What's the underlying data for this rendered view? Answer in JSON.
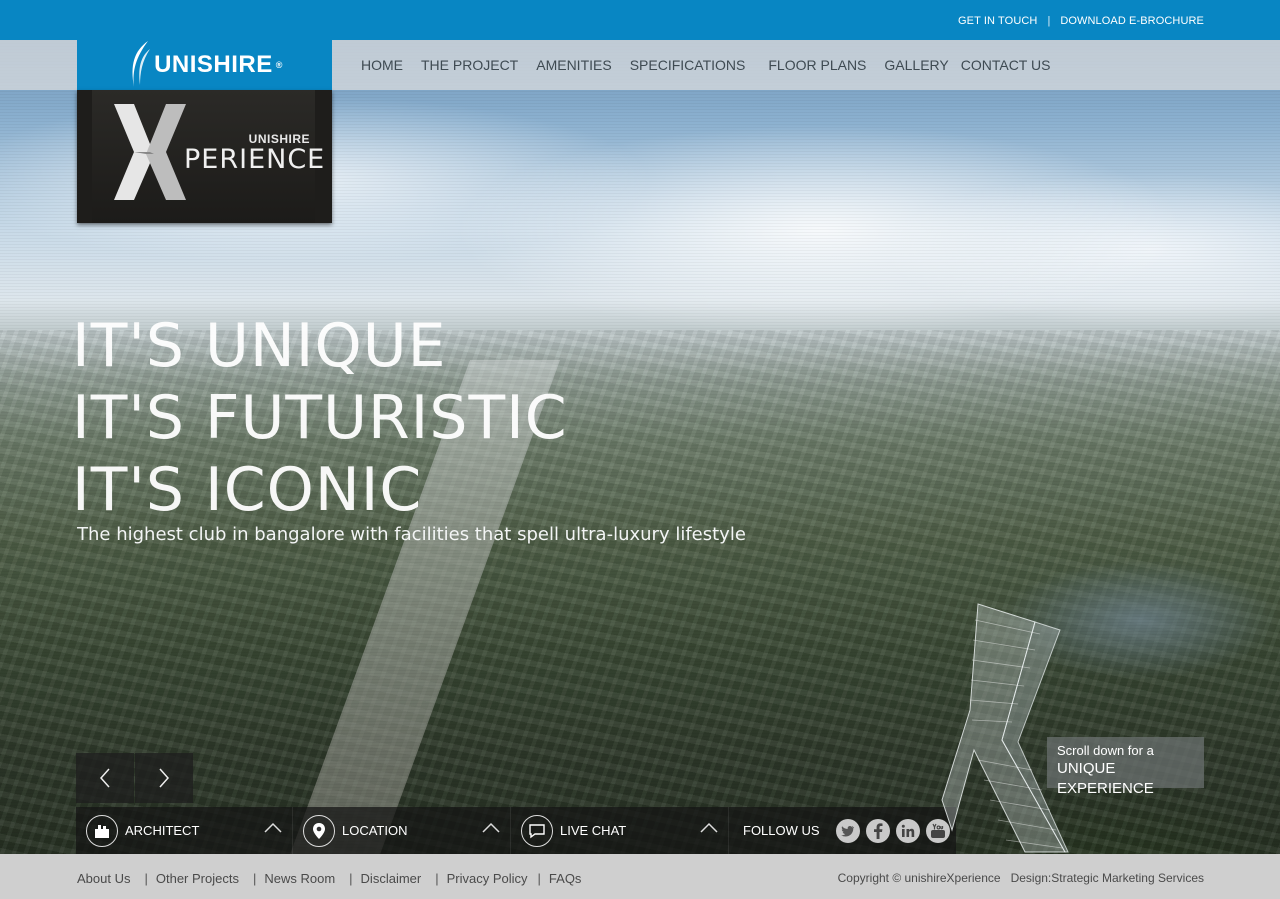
{
  "top_links": {
    "get_in_touch": "GET IN TOUCH",
    "separator": "|",
    "download": "DOWNLOAD E-BROCHURE"
  },
  "logo": {
    "brand": "UNISHIRE",
    "registered": "®"
  },
  "xperience_logo": {
    "small": "UNISHIRE",
    "word": "PERIENCE"
  },
  "nav": {
    "items": [
      "HOME",
      "THE PROJECT",
      "AMENITIES",
      "SPECIFICATIONS",
      "FLOOR PLANS",
      "GALLERY",
      "CONTACT US"
    ]
  },
  "hero": {
    "lines": [
      "IT'S  UNIQUE",
      "IT'S  FUTURISTIC",
      "IT'S  ICONIC"
    ],
    "tagline": "The highest club in bangalore with facilities that spell ultra-luxury lifestyle"
  },
  "bottom_bar": {
    "architect": "ARCHITECT",
    "location": "LOCATION",
    "live_chat": "LIVE CHAT",
    "follow_us": "FOLLOW US"
  },
  "scroll_hint": {
    "line1": "Scroll down for a",
    "line2": "UNIQUE EXPERIENCE"
  },
  "footer": {
    "links": [
      "About Us",
      "Other Projects",
      "News Room",
      "Disclaimer",
      "Privacy Policy",
      "FAQs"
    ],
    "separator": "|",
    "copyright": "Copyright © unishireXperience",
    "design": "Design:Strategic Marketing Services"
  },
  "colors": {
    "brand_blue": "#0886c3",
    "nav_text": "#3e4a52"
  }
}
